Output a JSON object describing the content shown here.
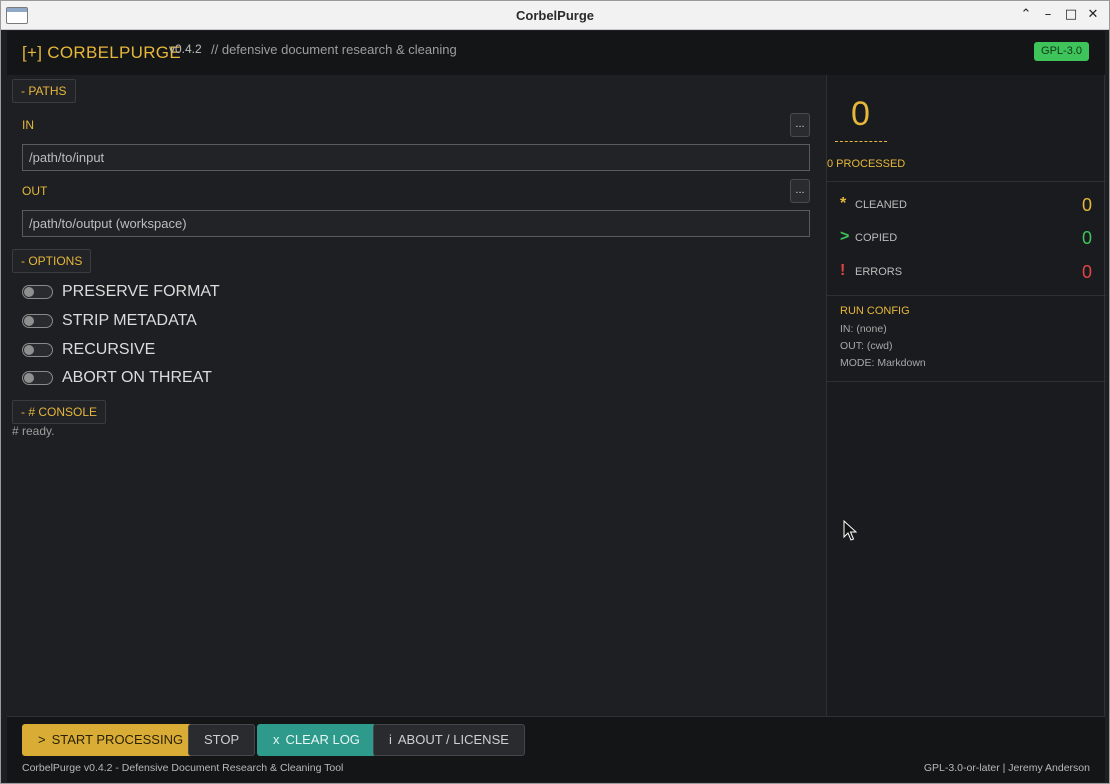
{
  "window": {
    "title": "CorbelPurge"
  },
  "header": {
    "brand": "[+] CORBELPURGE",
    "version": "v0.4.2",
    "tagline": "// defensive document research & cleaning",
    "license_badge": "GPL-3.0"
  },
  "paths": {
    "section_label": "-  PATHS",
    "in_label": "IN",
    "in_value": "/path/to/input",
    "out_label": "OUT",
    "out_value": "/path/to/output (workspace)",
    "browse_label": "..."
  },
  "options": {
    "section_label": "-  OPTIONS",
    "toggles": [
      {
        "label": "PRESERVE FORMAT",
        "on": false
      },
      {
        "label": "STRIP METADATA",
        "on": false
      },
      {
        "label": "RECURSIVE",
        "on": false
      },
      {
        "label": "ABORT ON THREAT",
        "on": false
      }
    ]
  },
  "console": {
    "section_label": "-  #  CONSOLE",
    "lines": [
      "#  ready."
    ]
  },
  "stats": {
    "processed_count": "0",
    "processed_label": "0 PROCESSED",
    "rows": [
      {
        "icon": "*",
        "label": "CLEANED",
        "value": "0",
        "color": "#e6b73a"
      },
      {
        "icon": ">",
        "label": "COPIED",
        "value": "0",
        "color": "#3ec45a"
      },
      {
        "icon": "!",
        "label": "ERRORS",
        "value": "0",
        "color": "#e04545"
      }
    ],
    "config_title": "RUN CONFIG",
    "config_lines": [
      "IN:  (none)",
      "OUT: (cwd)",
      "MODE: Markdown"
    ]
  },
  "footer": {
    "start_glyph": ">",
    "start_label": "START PROCESSING",
    "stop_label": "STOP",
    "clear_glyph": "x",
    "clear_label": "CLEAR LOG",
    "about_glyph": "i",
    "about_label": "ABOUT / LICENSE",
    "status_left": "CorbelPurge v0.4.2 - Defensive Document Research & Cleaning Tool",
    "status_right": "GPL-3.0-or-later | Jeremy Anderson"
  },
  "colors": {
    "accent": "#e6b73a",
    "success": "#3ec45a",
    "error": "#e04545",
    "teal": "#2e9a8c"
  }
}
